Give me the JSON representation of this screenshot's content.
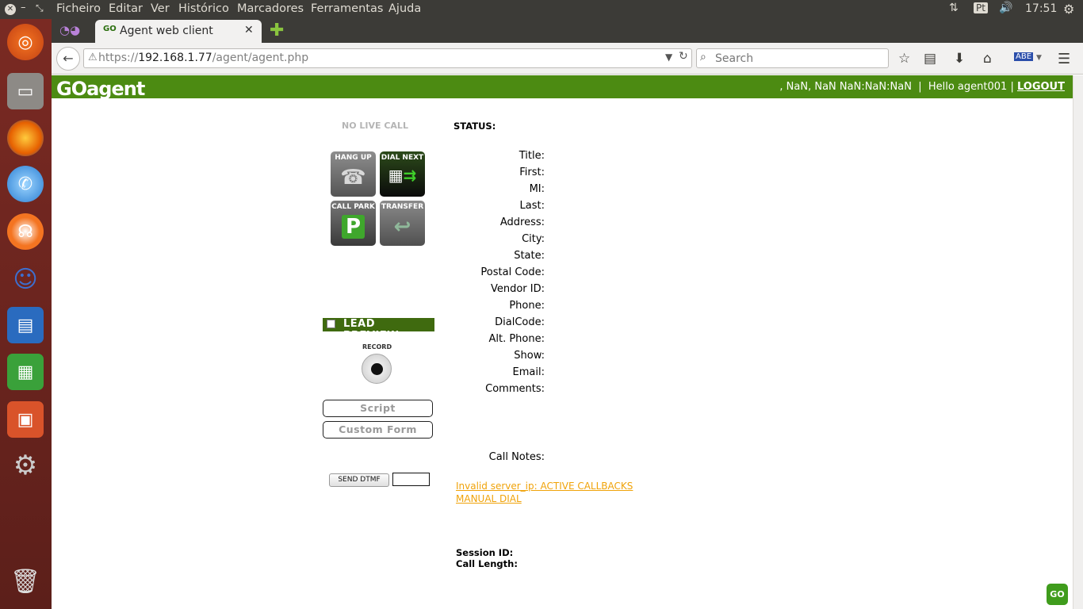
{
  "menubar": {
    "items": [
      "Ficheiro",
      "Editar",
      "Ver",
      "Histórico",
      "Marcadores",
      "Ferramentas",
      "Ajuda"
    ],
    "keyboard": "Pt",
    "clock": "17:51"
  },
  "browser": {
    "tab_title": "Agent web client",
    "url_prefix": "https://",
    "url_host": "192.168.1.77",
    "url_path": "/agent/agent.php",
    "search_placeholder": "Search"
  },
  "header": {
    "logo": "GOagent",
    "datetime": ", NaN, NaN NaN:NaN:NaN",
    "separator": "|",
    "greeting": "Hello agent001",
    "separator2": "|",
    "logout": "LOGOUT"
  },
  "call": {
    "no_live_call": "NO LIVE CALL",
    "status_label": "STATUS:"
  },
  "buttons": {
    "hang_up": "HANG UP",
    "dial_next": "DIAL NEXT",
    "call_park": "CALL PARK",
    "transfer": "TRANSFER",
    "lead_preview": "LEAD PREVIEW",
    "record": "RECORD",
    "script": "Script",
    "custom_form": "Custom Form",
    "send_dtmf": "SEND DTMF"
  },
  "fields": [
    "Title:",
    "First:",
    "MI:",
    "Last:",
    "Address:",
    "City:",
    "State:",
    "Postal Code:",
    "Vendor ID:",
    "Phone:",
    "DialCode:",
    "Alt. Phone:",
    "Show:",
    "Email:",
    "Comments:"
  ],
  "call_notes": "Call Notes:",
  "links": {
    "callbacks": "Invalid server_ip: ACTIVE CALLBACKS",
    "manual_dial": "MANUAL DIAL"
  },
  "session": {
    "session_id": "Session ID:",
    "call_length": "Call Length:"
  },
  "corner_logo": "GO"
}
